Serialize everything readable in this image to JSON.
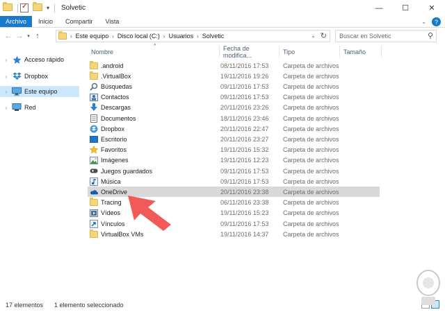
{
  "window": {
    "title": "Solvetic",
    "minimize_glyph": "—",
    "maximize_glyph": "☐",
    "close_glyph": "✕"
  },
  "ribbon": {
    "tabs": [
      "Archivo",
      "Inicio",
      "Compartir",
      "Vista"
    ]
  },
  "address": {
    "crumbs": [
      "Este equipo",
      "Disco local (C:)",
      "Usuarios",
      "Solvetic"
    ]
  },
  "search": {
    "placeholder": "Buscar en Solvetic"
  },
  "sidebar": {
    "items": [
      {
        "label": "Acceso rápido",
        "icon": "star-icon"
      },
      {
        "label": "Dropbox",
        "icon": "dropbox-icon"
      },
      {
        "label": "Este equipo",
        "icon": "computer-icon"
      },
      {
        "label": "Red",
        "icon": "network-icon"
      }
    ]
  },
  "columns": {
    "name": "Nombre",
    "date": "Fecha de modifica...",
    "type": "Tipo",
    "size": "Tamaño"
  },
  "files": [
    {
      "name": ".android",
      "date": "08/11/2016 17:53",
      "type": "Carpeta de archivos",
      "icon": "folder-icon"
    },
    {
      "name": ".VirtualBox",
      "date": "19/11/2016 19:26",
      "type": "Carpeta de archivos",
      "icon": "folder-icon"
    },
    {
      "name": "Búsquedas",
      "date": "09/11/2016 17:53",
      "type": "Carpeta de archivos",
      "icon": "search-folder-icon"
    },
    {
      "name": "Contactos",
      "date": "09/11/2016 17:53",
      "type": "Carpeta de archivos",
      "icon": "contacts-icon"
    },
    {
      "name": "Descargas",
      "date": "20/11/2016 23:26",
      "type": "Carpeta de archivos",
      "icon": "downloads-icon"
    },
    {
      "name": "Documentos",
      "date": "18/11/2016 23:46",
      "type": "Carpeta de archivos",
      "icon": "documents-icon"
    },
    {
      "name": "Dropbox",
      "date": "20/11/2016 22:47",
      "type": "Carpeta de archivos",
      "icon": "dropbox-icon"
    },
    {
      "name": "Escritorio",
      "date": "20/11/2016 23:27",
      "type": "Carpeta de archivos",
      "icon": "desktop-icon"
    },
    {
      "name": "Favoritos",
      "date": "19/11/2016 15:32",
      "type": "Carpeta de archivos",
      "icon": "favorites-icon"
    },
    {
      "name": "Imágenes",
      "date": "19/11/2016 12:23",
      "type": "Carpeta de archivos",
      "icon": "pictures-icon"
    },
    {
      "name": "Juegos guardados",
      "date": "09/11/2016 17:53",
      "type": "Carpeta de archivos",
      "icon": "saved-games-icon"
    },
    {
      "name": "Música",
      "date": "09/11/2016 17:53",
      "type": "Carpeta de archivos",
      "icon": "music-icon"
    },
    {
      "name": "OneDrive",
      "date": "20/11/2016 23:38",
      "type": "Carpeta de archivos",
      "icon": "onedrive-icon"
    },
    {
      "name": "Tracing",
      "date": "06/11/2016 23:38",
      "type": "Carpeta de archivos",
      "icon": "folder-icon"
    },
    {
      "name": "Vídeos",
      "date": "19/11/2016 15:23",
      "type": "Carpeta de archivos",
      "icon": "videos-icon"
    },
    {
      "name": "Vínculos",
      "date": "09/11/2016 17:53",
      "type": "Carpeta de archivos",
      "icon": "links-icon"
    },
    {
      "name": "VirtualBox VMs",
      "date": "19/11/2016 14:37",
      "type": "Carpeta de archivos",
      "icon": "folder-icon"
    }
  ],
  "selected_file": "OneDrive",
  "status": {
    "count": "17 elementos",
    "selection": "1 elemento seleccionado"
  },
  "colors": {
    "accent": "#1979ca",
    "selection": "#cce8ff",
    "row_selected": "#d9d9d9",
    "annotation_arrow": "#f25a5a"
  }
}
